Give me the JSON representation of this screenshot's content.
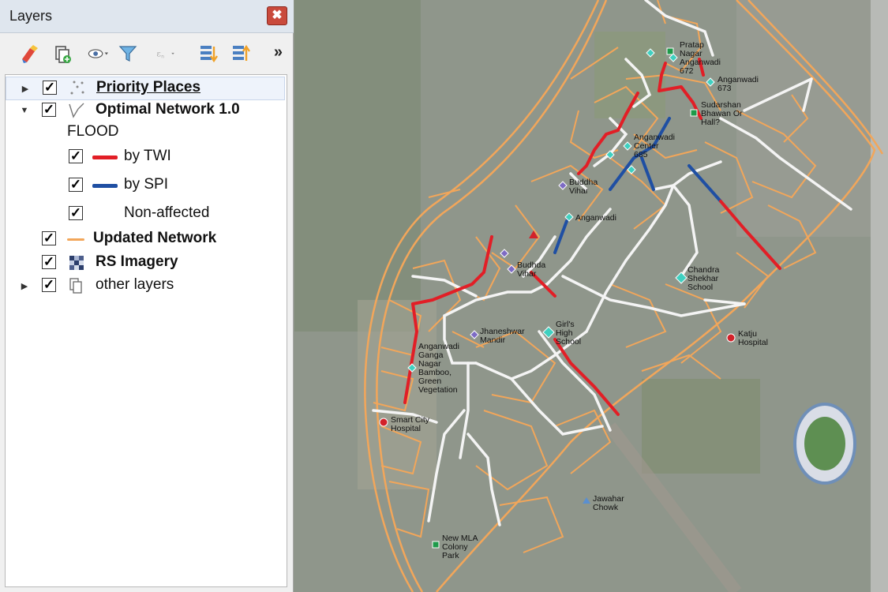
{
  "panel": {
    "title": "Layers",
    "close_icon": "✖",
    "more_icon": "»"
  },
  "layers": [
    {
      "label": "Priority Places",
      "checked": "✓"
    },
    {
      "label": "Optimal Network 1.0",
      "checked": "✓"
    },
    {
      "label": "FLOOD"
    },
    {
      "label": "by TWI",
      "checked": "✓",
      "color": "#e21e26"
    },
    {
      "label": "by SPI",
      "checked": "✓",
      "color": "#1f4fa3"
    },
    {
      "label": "Non-affected",
      "checked": "✓"
    },
    {
      "label": "Updated Network",
      "checked": "✓",
      "color": "#f2a65a"
    },
    {
      "label": "RS Imagery",
      "checked": "✓"
    },
    {
      "label": "other layers",
      "checked": "✓"
    }
  ],
  "map_labels": [
    "Pratap\nNagar\nAnganwadi\n672",
    "Anganwadi\n673",
    "Sudarshan\nBhawan Or\nHall?",
    "Anganwadi\nCenter\n685",
    "Buddha\nVihar",
    "Anganwadi",
    "Budhda\nVihar",
    "Chandra\nShekhar\nSchool",
    "Jhaneshwar\nMandir",
    "Girl's\nHigh\nSchool",
    "Katju\nHospital",
    "Anganwadi\nGanga\nNagar\nBamboo,\nGreen\nVegetation",
    "Smart City\nHospital",
    "Jawahar\nChowk",
    "New MLA\nColony\nPark"
  ],
  "colors": {
    "twi": "#e21e26",
    "spi": "#1f4fa3",
    "network": "#f2a65a",
    "nonaffected": "#f4f4f4",
    "poi_green": "#1e9a4a",
    "poi_cyan": "#3fd0c0",
    "poi_purple": "#7d6bc4",
    "poi_red": "#d3222a"
  }
}
